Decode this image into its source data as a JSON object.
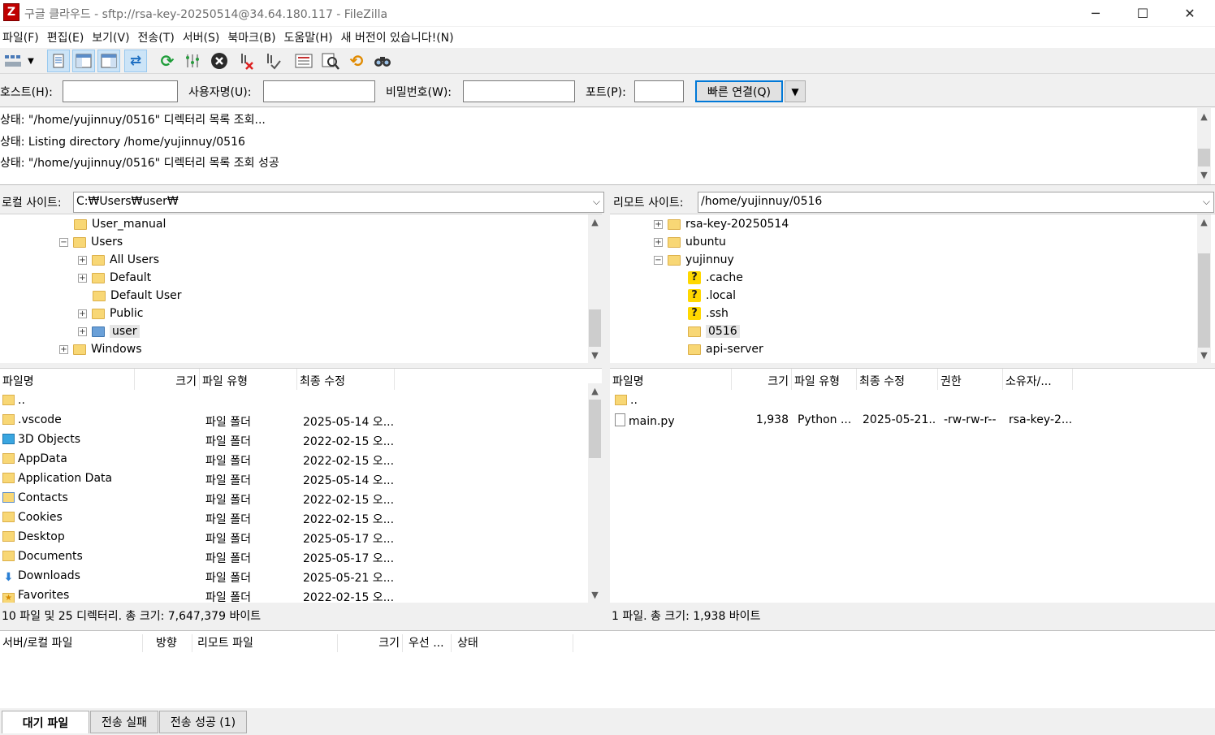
{
  "window": {
    "title": "구글 클라우드 - sftp://rsa-key-20250514@34.64.180.117 - FileZilla",
    "app_icon": "Z",
    "minimize": "─",
    "maximize": "☐",
    "close": "✕"
  },
  "menu": [
    "파일(F)",
    "편집(E)",
    "보기(V)",
    "전송(T)",
    "서버(S)",
    "북마크(B)",
    "도움말(H)",
    "새 버전이 있습니다!(N)"
  ],
  "toolbar": {
    "icons": [
      "site-manager-icon",
      "dropdown-arrow-icon",
      "message-log-icon",
      "local-tree-icon",
      "remote-tree-icon",
      "transfer-queue-icon",
      "refresh-icon",
      "process-queue-icon",
      "cancel-icon",
      "disconnect-icon",
      "reconnect-icon",
      "filter-icon",
      "compare-icon",
      "sync-browse-icon",
      "search-icon"
    ]
  },
  "quickconnect": {
    "host_label": "호스트(H):",
    "user_label": "사용자명(U):",
    "pass_label": "비밀번호(W):",
    "port_label": "포트(P):",
    "host_value": "",
    "user_value": "",
    "pass_value": "",
    "port_value": "",
    "connect_label": "빠른 연결(Q)",
    "dropdown": "▼"
  },
  "log": [
    "상태:  \"/home/yujinnuy/0516\" 디렉터리 목록 조회...",
    "상태:  Listing directory /home/yujinnuy/0516",
    "상태:  \"/home/yujinnuy/0516\" 디렉터리 목록 조회 성공"
  ],
  "local": {
    "site_label": "로컬 사이트:",
    "path": "C:₩Users₩user₩",
    "tree": [
      {
        "label": "User_manual",
        "expander": "",
        "icon": "folder"
      },
      {
        "label": "Users",
        "expander": "−",
        "icon": "folder"
      },
      {
        "label": "All Users",
        "expander": "+",
        "icon": "folder"
      },
      {
        "label": "Default",
        "expander": "+",
        "icon": "folder"
      },
      {
        "label": "Default User",
        "expander": "",
        "icon": "folder"
      },
      {
        "label": "Public",
        "expander": "+",
        "icon": "folder"
      },
      {
        "label": "user",
        "expander": "+",
        "icon": "user-folder"
      },
      {
        "label": "Windows",
        "expander": "+",
        "icon": "folder"
      }
    ],
    "columns": [
      "파일명",
      "크기",
      "파일 유형",
      "최종 수정"
    ],
    "files": [
      {
        "name": "..",
        "size": "",
        "type": "",
        "modified": "",
        "icon": "folder"
      },
      {
        "name": ".vscode",
        "size": "",
        "type": "파일 폴더",
        "modified": "2025-05-14 오...",
        "icon": "folder"
      },
      {
        "name": "3D Objects",
        "size": "",
        "type": "파일 폴더",
        "modified": "2022-02-15 오...",
        "icon": "3d-objects"
      },
      {
        "name": "AppData",
        "size": "",
        "type": "파일 폴더",
        "modified": "2022-02-15 오...",
        "icon": "folder"
      },
      {
        "name": "Application Data",
        "size": "",
        "type": "파일 폴더",
        "modified": "2025-05-14 오...",
        "icon": "folder"
      },
      {
        "name": "Contacts",
        "size": "",
        "type": "파일 폴더",
        "modified": "2022-02-15 오...",
        "icon": "contacts"
      },
      {
        "name": "Cookies",
        "size": "",
        "type": "파일 폴더",
        "modified": "2022-02-15 오...",
        "icon": "folder"
      },
      {
        "name": "Desktop",
        "size": "",
        "type": "파일 폴더",
        "modified": "2025-05-17 오...",
        "icon": "folder"
      },
      {
        "name": "Documents",
        "size": "",
        "type": "파일 폴더",
        "modified": "2025-05-17 오...",
        "icon": "folder"
      },
      {
        "name": "Downloads",
        "size": "",
        "type": "파일 폴더",
        "modified": "2025-05-21 오...",
        "icon": "downloads"
      },
      {
        "name": "Favorites",
        "size": "",
        "type": "파일 폴더",
        "modified": "2022-02-15 오...",
        "icon": "favorites"
      }
    ],
    "status": "10 파일 및 25 디렉터리. 총 크기: 7,647,379 바이트"
  },
  "remote": {
    "site_label": "리모트 사이트:",
    "path": "/home/yujinnuy/0516",
    "tree": [
      {
        "label": "rsa-key-20250514",
        "expander": "+",
        "icon": "folder",
        "level": 0
      },
      {
        "label": "ubuntu",
        "expander": "+",
        "icon": "folder",
        "level": 0
      },
      {
        "label": "yujinnuy",
        "expander": "−",
        "icon": "folder",
        "level": 0
      },
      {
        "label": ".cache",
        "expander": "",
        "icon": "unknown",
        "level": 1
      },
      {
        "label": ".local",
        "expander": "",
        "icon": "unknown",
        "level": 1
      },
      {
        "label": ".ssh",
        "expander": "",
        "icon": "unknown",
        "level": 1
      },
      {
        "label": "0516",
        "expander": "",
        "icon": "folder",
        "level": 1
      },
      {
        "label": "api-server",
        "expander": "",
        "icon": "folder",
        "level": 1
      }
    ],
    "columns": [
      "파일명",
      "크기",
      "파일 유형",
      "최종 수정",
      "권한",
      "소유자/..."
    ],
    "files": [
      {
        "name": "..",
        "size": "",
        "type": "",
        "modified": "",
        "perm": "",
        "owner": "",
        "icon": "folder"
      },
      {
        "name": "main.py",
        "size": "1,938",
        "type": "Python ...",
        "modified": "2025-05-21...",
        "perm": "-rw-rw-r--",
        "owner": "rsa-key-2...",
        "icon": "file"
      }
    ],
    "status": "1 파일. 총 크기: 1,938 바이트"
  },
  "queue": {
    "columns": [
      "서버/로컬 파일",
      "방향",
      "리모트 파일",
      "크기",
      "우선 ...",
      "상태"
    ]
  },
  "tabs": [
    "대기 파일",
    "전송 실패",
    "전송 성공 (1)"
  ],
  "colors": {
    "accent": "#0078d7",
    "folder": "#f8d775",
    "selection": "#cce4f7"
  }
}
